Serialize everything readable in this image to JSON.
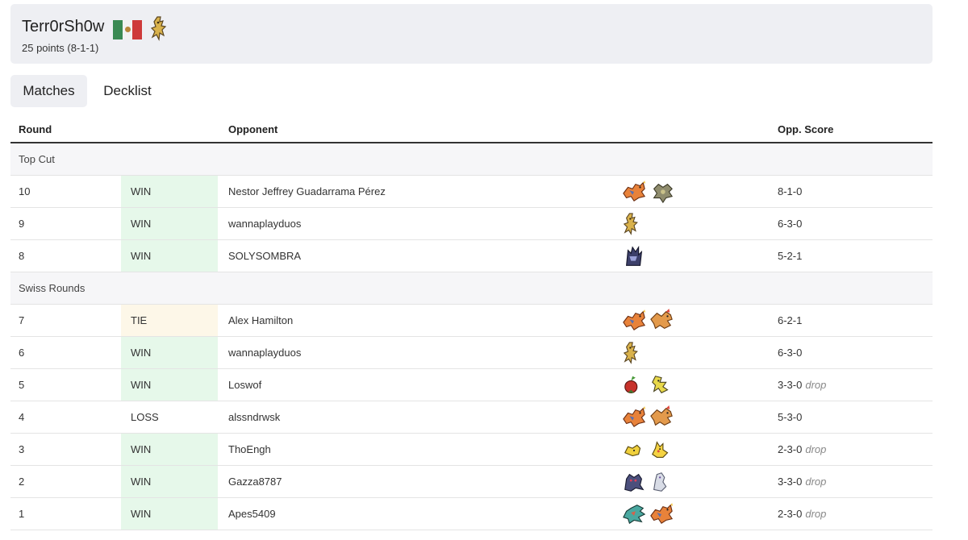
{
  "player": {
    "name": "Terr0rSh0w",
    "points": "25 points (8-1-1)",
    "flag_colors": [
      "#3a8a53",
      "#f2f2f2",
      "#ce3a3a"
    ]
  },
  "tabs": [
    {
      "label": "Matches",
      "active": true
    },
    {
      "label": "Decklist",
      "active": false
    }
  ],
  "table": {
    "headers": {
      "round": "Round",
      "opponent": "Opponent",
      "score": "Opp. Score"
    },
    "sections": [
      {
        "label": "Top Cut",
        "rows": [
          {
            "round": "10",
            "result": "WIN",
            "opponent": "Nestor Jeffrey Guadarrama Pérez",
            "deck": [
              "charizard-icon",
              "gear-pokemon-icon"
            ],
            "score": "8-1-0",
            "drop": ""
          },
          {
            "round": "9",
            "result": "WIN",
            "opponent": "wannaplayduos",
            "deck": [
              "sandy-shocks-icon"
            ],
            "score": "6-3-0",
            "drop": ""
          },
          {
            "round": "8",
            "result": "WIN",
            "opponent": "SOLYSOMBRA",
            "deck": [
              "dark-armor-icon"
            ],
            "score": "5-2-1",
            "drop": ""
          }
        ]
      },
      {
        "label": "Swiss Rounds",
        "rows": [
          {
            "round": "7",
            "result": "TIE",
            "opponent": "Alex Hamilton",
            "deck": [
              "charizard-icon",
              "pidgeot-icon"
            ],
            "score": "6-2-1",
            "drop": ""
          },
          {
            "round": "6",
            "result": "WIN",
            "opponent": "wannaplayduos",
            "deck": [
              "sandy-shocks-icon"
            ],
            "score": "6-3-0",
            "drop": ""
          },
          {
            "round": "5",
            "result": "WIN",
            "opponent": "Loswof",
            "deck": [
              "apple-pokemon-icon",
              "electric-pokemon-icon"
            ],
            "score": "3-3-0",
            "drop": "drop"
          },
          {
            "round": "4",
            "result": "LOSS",
            "opponent": "alssndrwsk",
            "deck": [
              "charizard-icon",
              "pidgeot-icon"
            ],
            "score": "5-3-0",
            "drop": ""
          },
          {
            "round": "3",
            "result": "WIN",
            "opponent": "ThoEngh",
            "deck": [
              "yellow-mouse-icon",
              "pikachu-icon"
            ],
            "score": "2-3-0",
            "drop": "drop"
          },
          {
            "round": "2",
            "result": "WIN",
            "opponent": "Gazza8787",
            "deck": [
              "ghost-pokemon-icon",
              "pale-pokemon-icon"
            ],
            "score": "3-3-0",
            "drop": "drop"
          },
          {
            "round": "1",
            "result": "WIN",
            "opponent": "Apes5409",
            "deck": [
              "dragon-pokemon-icon",
              "charizard-icon"
            ],
            "score": "2-3-0",
            "drop": "drop"
          }
        ]
      }
    ]
  },
  "colors": {
    "win_bg": "#e6f8ea",
    "tie_bg": "#fdf7e8",
    "header_bg": "#eeeff3"
  }
}
